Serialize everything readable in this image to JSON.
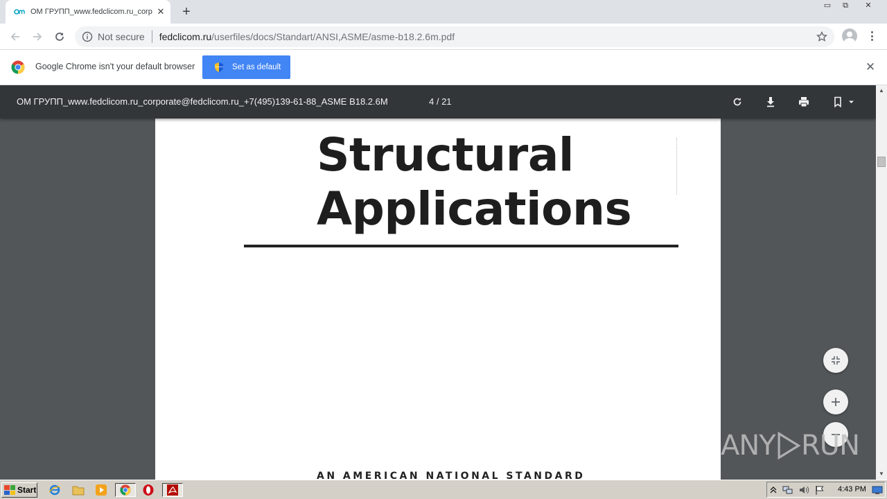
{
  "browser": {
    "tab": {
      "title": "ОМ ГРУПП_www.fedclicom.ru_corporate@fedclicom.ru_+7(495)139-61-88_ASME B18.2.6M",
      "favicon": "om-logo-icon"
    },
    "new_tab_label": "+",
    "window_controls": {
      "minimize": "▭",
      "restore": "⧉",
      "close": "✕"
    },
    "address": {
      "security_label": "Not secure",
      "host": "fedclicom.ru",
      "path": "/userfiles/docs/Standart/ANSI,ASME/asme-b18.2.6m.pdf"
    }
  },
  "infobar": {
    "message": "Google Chrome isn't your default browser",
    "button_label": "Set as default",
    "close_label": "✕"
  },
  "pdf": {
    "title": "ОМ ГРУПП_www.fedclicom.ru_corporate@fedclicom.ru_+7(495)139-61-88_ASME B18.2.6M",
    "page_indicator": "4 / 21",
    "page": {
      "heading_line1": "Structural",
      "heading_line2": "Applications",
      "footer_text": "AN AMERICAN NATIONAL STANDARD"
    }
  },
  "watermark": {
    "text_left": "ANY",
    "text_right": "RUN"
  },
  "taskbar": {
    "start_label": "Start",
    "clock": "4:43 PM"
  },
  "colors": {
    "accent": "#4285f4",
    "pdf_toolbar": "#323639",
    "pdf_background": "#525659"
  }
}
